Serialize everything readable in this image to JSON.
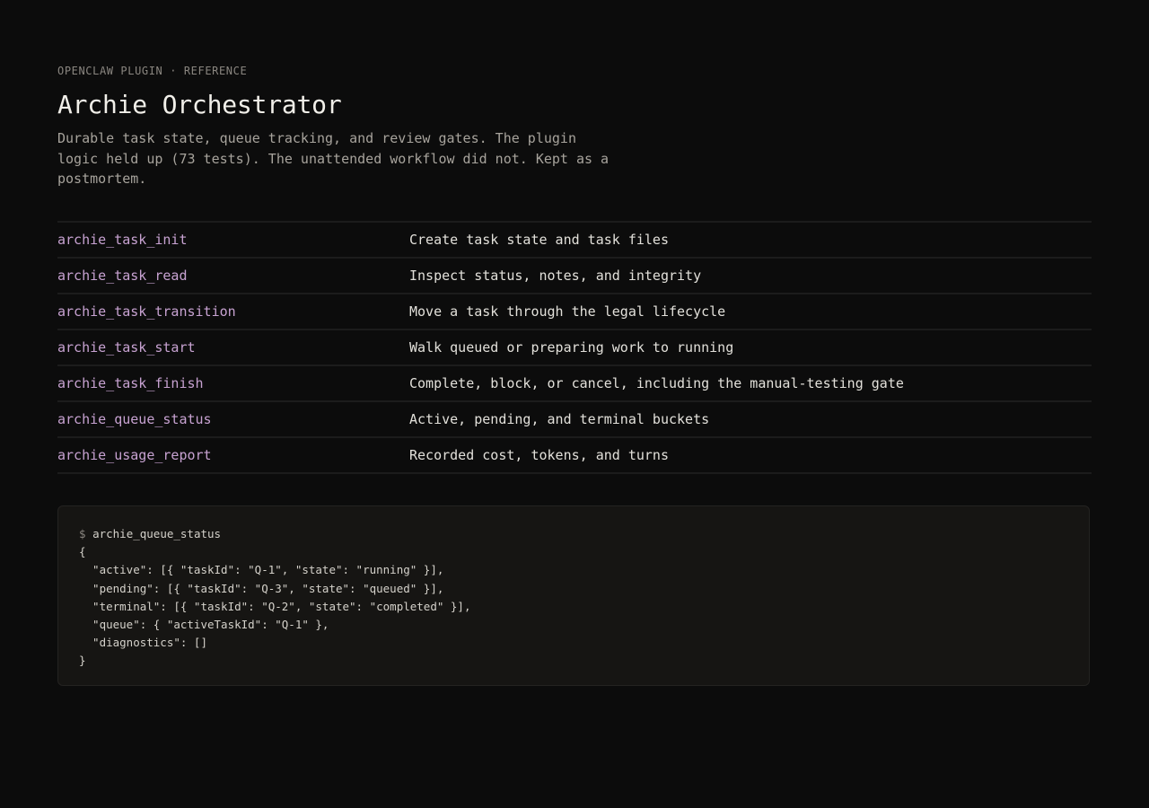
{
  "header": {
    "eyebrow": "OPENCLAW PLUGIN · REFERENCE",
    "title": "Archie Orchestrator",
    "lede": "Durable task state, queue tracking, and review gates. The plugin logic held up (73 tests). The unattended workflow did not. Kept as a postmortem."
  },
  "tools": [
    {
      "name": "archie_task_init",
      "description": "Create task state and task files"
    },
    {
      "name": "archie_task_read",
      "description": "Inspect status, notes, and integrity"
    },
    {
      "name": "archie_task_transition",
      "description": "Move a task through the legal lifecycle"
    },
    {
      "name": "archie_task_start",
      "description": "Walk queued or preparing work to running"
    },
    {
      "name": "archie_task_finish",
      "description": "Complete, block, or cancel, including the manual-testing gate"
    },
    {
      "name": "archie_queue_status",
      "description": "Active, pending, and terminal buckets"
    },
    {
      "name": "archie_usage_report",
      "description": "Recorded cost, tokens, and turns"
    }
  ],
  "code_sample": {
    "prompt": "$",
    "command": "archie_queue_status",
    "lines": [
      "{",
      "  \"active\": [{ \"taskId\": \"Q-1\", \"state\": \"running\" }],",
      "  \"pending\": [{ \"taskId\": \"Q-3\", \"state\": \"queued\" }],",
      "  \"terminal\": [{ \"taskId\": \"Q-2\", \"state\": \"completed\" }],",
      "  \"queue\": { \"activeTaskId\": \"Q-1\" },",
      "  \"diagnostics\": []",
      "}"
    ]
  },
  "colors": {
    "background": "#0c0c0c",
    "tool_name": "#c7a2d1",
    "code_background": "#161513"
  }
}
